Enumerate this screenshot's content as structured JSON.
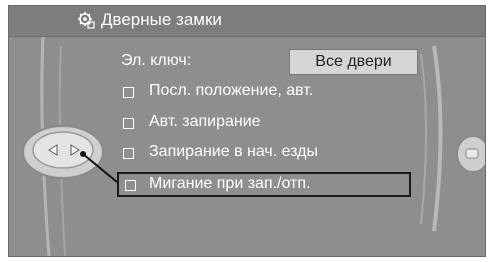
{
  "title": "Дверные замки",
  "key_label": "Эл. ключ:",
  "key_value": "Все двери",
  "options": [
    {
      "label": "Посл. положение, авт.",
      "checked": false
    },
    {
      "label": "Авт. запирание",
      "checked": false
    },
    {
      "label": "Запирание в нач. езды",
      "checked": false
    },
    {
      "label": "Мигание при зап./отп.",
      "checked": false,
      "selected": true
    }
  ],
  "colors": {
    "screen": "#8e8e8e",
    "title_bar": "#7d7d7d",
    "value_box": "#d6d6d6",
    "text": "#ffffff"
  },
  "icons": [
    "settings-gear-icon",
    "controller-knob-icon",
    "left-arrow-icon",
    "right-arrow-icon",
    "menu-button-icon"
  ]
}
